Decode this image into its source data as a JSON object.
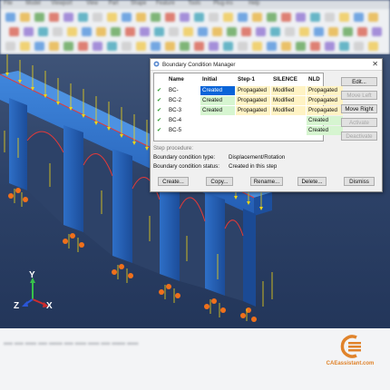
{
  "app": {
    "menu_items": [
      "File",
      "Model",
      "Viewport",
      "View",
      "Part",
      "Shape",
      "Feature",
      "Tools",
      "Plug-ins",
      "Help"
    ]
  },
  "dialog": {
    "title": "Boundary Condition Manager",
    "columns": [
      "Name",
      "Initial",
      "Step-1",
      "SILENCE",
      "NLD"
    ],
    "rows": [
      {
        "check": "✔",
        "name": "BC-",
        "cells": [
          "Created",
          "Propagated",
          "Modified",
          "Propagated"
        ]
      },
      {
        "check": "✔",
        "name": "BC-2",
        "cells": [
          "Created",
          "Propagated",
          "Modified",
          "Propagated"
        ]
      },
      {
        "check": "✔",
        "name": "BC-3",
        "cells": [
          "Created",
          "Propagated",
          "Modified",
          "Propagated"
        ]
      },
      {
        "check": "✔",
        "name": "BC-4",
        "cells": [
          "",
          "",
          "",
          "Created"
        ]
      },
      {
        "check": "✔",
        "name": "BC-5",
        "cells": [
          "",
          "",
          "",
          "Created"
        ]
      }
    ],
    "side_buttons": [
      "Edit...",
      "Move Left",
      "Move Right",
      "Activate",
      "Deactivate"
    ],
    "step_procedure_label": "Step procedure:",
    "bc_type_label": "Boundary condition type:",
    "bc_type_value": "Displacement/Rotation",
    "bc_status_label": "Boundary condition status:",
    "bc_status_value": "Created in this step",
    "bottom_buttons": [
      "Create...",
      "Copy...",
      "Rename...",
      "Delete...",
      "Dismiss"
    ],
    "close_symbol": "✕"
  },
  "triad": {
    "y": "Y",
    "z": "Z",
    "x": "X"
  },
  "logo": {
    "text": "CAEassistant.com"
  },
  "colors": {
    "bridge": "#2f6ec6",
    "selected": "#0a64d8",
    "propagated": "#fff3c4",
    "modified": "#fff3c4",
    "created_cell": "#d6f5d0",
    "load_arrows": "#f0d515",
    "bc_markers": "#f0701b"
  },
  "icons": [
    "window-icon",
    "close-icon",
    "check-icon",
    "axis-triad-icon",
    "caeassistant-logo-icon"
  ]
}
